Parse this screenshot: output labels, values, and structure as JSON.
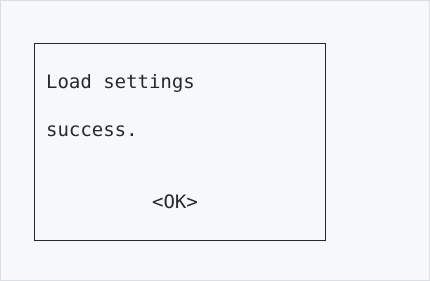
{
  "dialog": {
    "message_line1": "Load settings",
    "message_line2": "success.",
    "ok_label": "<OK>"
  }
}
